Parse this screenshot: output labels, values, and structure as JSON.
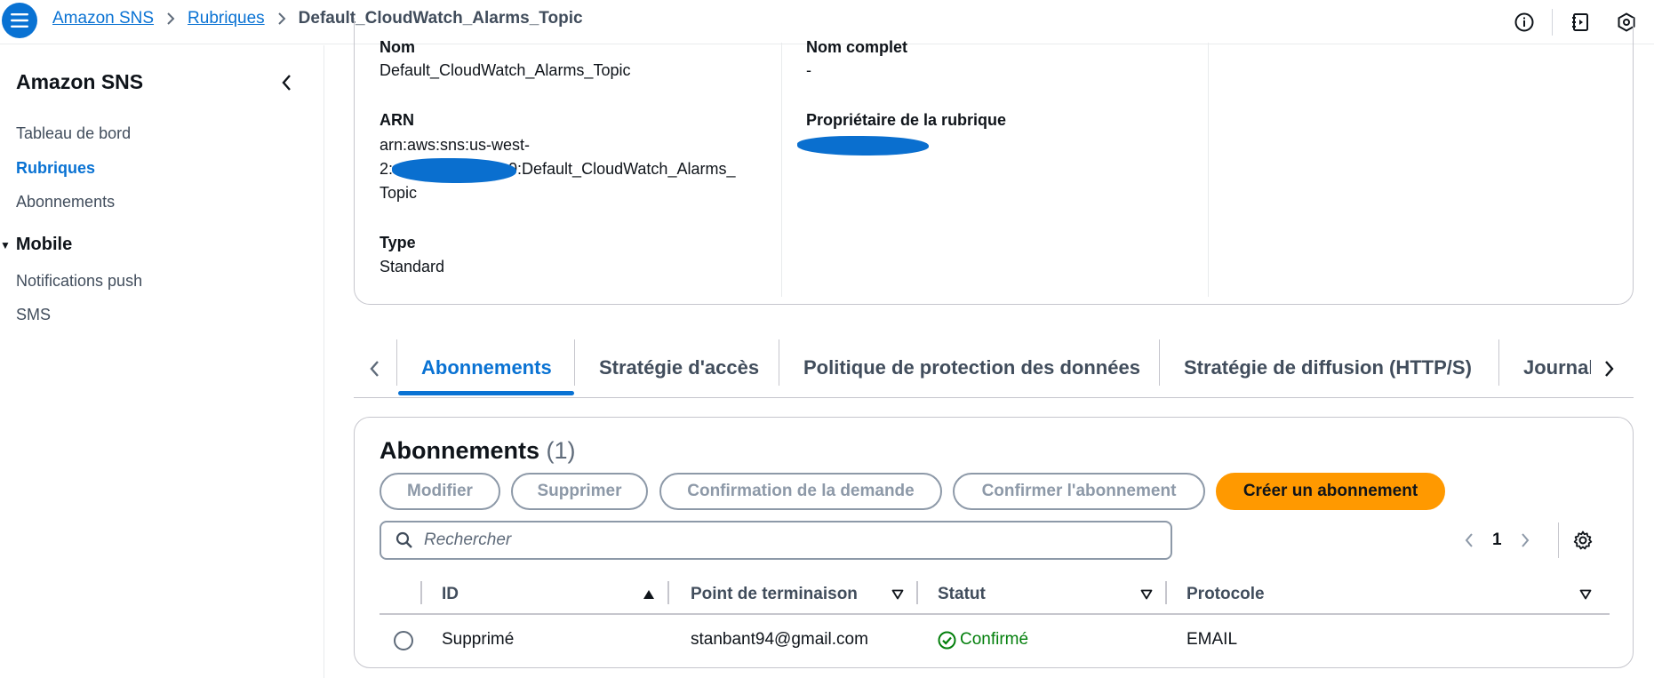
{
  "breadcrumb": {
    "items": [
      "Amazon SNS",
      "Rubriques"
    ],
    "current": "Default_CloudWatch_Alarms_Topic"
  },
  "top_icons": [
    "info-icon",
    "notes-icon",
    "settings-hex-icon"
  ],
  "sidebar": {
    "title": "Amazon SNS",
    "items": [
      {
        "label": "Tableau de bord",
        "active": false
      },
      {
        "label": "Rubriques",
        "active": true
      },
      {
        "label": "Abonnements",
        "active": false
      }
    ],
    "section": {
      "label": "Mobile",
      "items": [
        "Notifications push",
        "SMS"
      ]
    }
  },
  "details": {
    "name_label": "Nom",
    "name_value": "Default_CloudWatch_Alarms_Topic",
    "arn_label": "ARN",
    "arn_line1": "arn:aws:sns:us-west-",
    "arn_line2_prefix": "2:",
    "arn_line2_suffix": "0:Default_CloudWatch_Alarms_",
    "arn_line3": "Topic",
    "type_label": "Type",
    "type_value": "Standard",
    "fullname_label": "Nom complet",
    "fullname_value": "-",
    "owner_label": "Propriétaire de la rubrique"
  },
  "tabs": [
    {
      "label": "Abonnements",
      "active": true
    },
    {
      "label": "Stratégie d'accès",
      "active": false
    },
    {
      "label": "Politique de protection des données",
      "active": false
    },
    {
      "label": "Stratégie de diffusion (HTTP/S)",
      "active": false
    },
    {
      "label": "Journal",
      "active": false
    }
  ],
  "subscriptions": {
    "title": "Abonnements",
    "count": "(1)",
    "buttons": {
      "edit": "Modifier",
      "delete": "Supprimer",
      "request_confirmation": "Confirmation de la demande",
      "confirm_subscription": "Confirmer l'abonnement",
      "create": "Créer un abonnement"
    },
    "search_placeholder": "Rechercher",
    "page": "1",
    "columns": [
      "ID",
      "Point de terminaison",
      "Statut",
      "Protocole"
    ],
    "rows": [
      {
        "id": "Supprimé",
        "endpoint": "stanbant94@gmail.com",
        "status": "Confirmé",
        "protocol": "EMAIL"
      }
    ]
  },
  "colors": {
    "accent": "#0972d3",
    "primary_button": "#ff9900",
    "success": "#037f0c",
    "redaction": "#0a6fcf"
  }
}
